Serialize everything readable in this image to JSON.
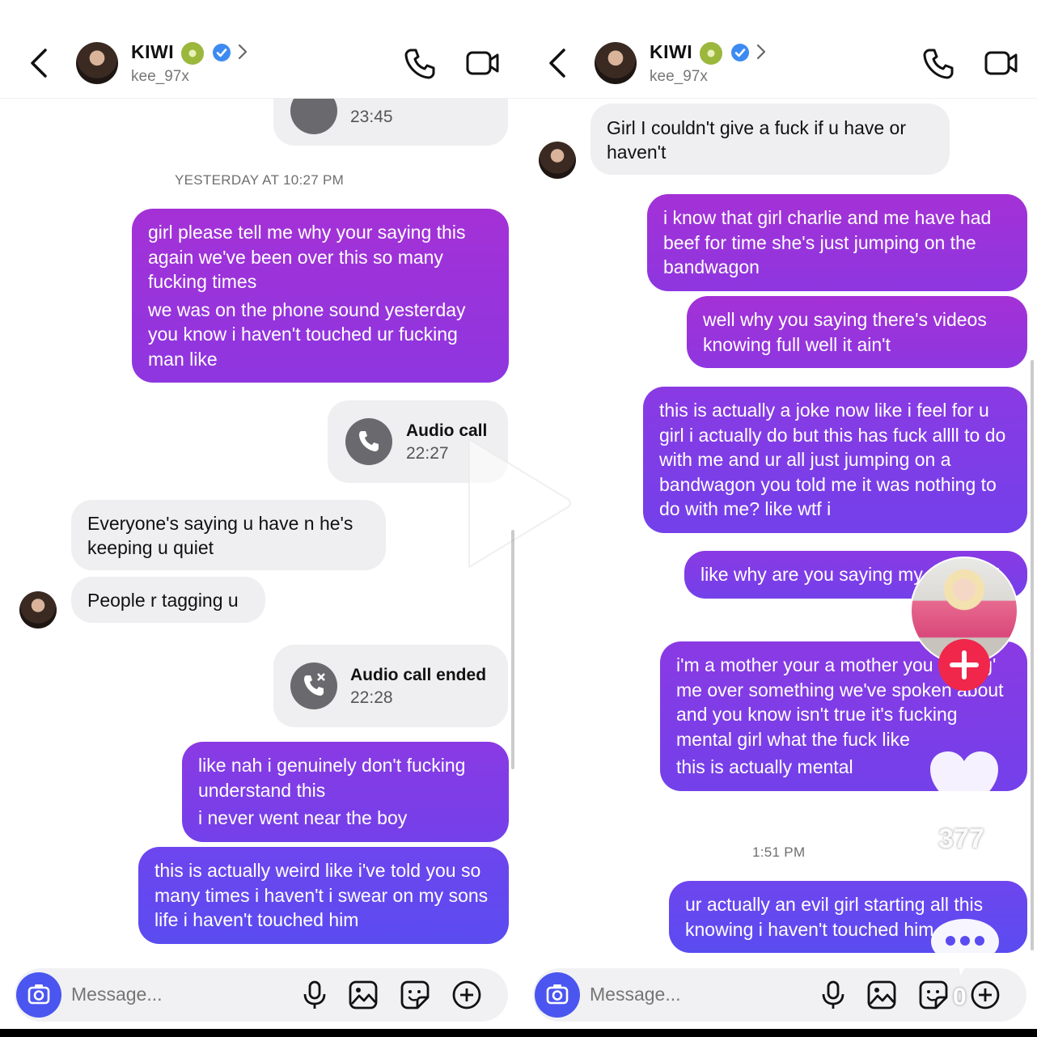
{
  "left": {
    "header": {
      "name": "KIWI",
      "handle": "kee_97x"
    },
    "top_call_time": "23:45",
    "timestamp": "YESTERDAY AT 10:27 PM",
    "msg1": [
      "girl please tell me why your saying this again we've been over this so many fucking times",
      "we was on the phone sound yesterday you know i haven't touched ur fucking man like"
    ],
    "call1": {
      "title": "Audio call",
      "time": "22:27"
    },
    "in1": "Everyone's saying u have n he's keeping u quiet",
    "in2": "People r tagging u",
    "call2": {
      "title": "Audio call ended",
      "time": "22:28"
    },
    "msg2": [
      "like nah i genuinely don't fucking understand this",
      "i never went near the boy"
    ],
    "msg3": "this is actually weird like i've told you so many times i haven't i swear on my sons life i haven't touched him",
    "composer": {
      "placeholder": "Message..."
    }
  },
  "right": {
    "header": {
      "name": "KIWI",
      "handle": "kee_97x"
    },
    "in1": "Girl I couldn't give a fuck if u have or haven't",
    "msg1": "i know that girl charlie and me have had beef for time she's just jumping on the bandwagon",
    "msg2": "well why you saying there's videos knowing full well it ain't",
    "msg3": "this is actually a joke now like i feel for u girl i actually do but this has fuck allll to do with me and ur all just jumping on a bandwagon you told me it was nothing to do with me? like wtf i",
    "msg4": "like why are you saying my name??!",
    "msg5": [
      "i'm a mother your a mother you 'outing' me over something we've spoken about and you know isn't true it's fucking mental girl what the fuck like",
      "this is actually mental"
    ],
    "timestamp": "1:51 PM",
    "msg6": "ur actually an evil girl starting all this knowing i haven't touched him",
    "composer": {
      "placeholder": "Message..."
    }
  },
  "overlay": {
    "likes": "377",
    "comments": "0"
  },
  "colors": {
    "accent": "#4b56f0",
    "verified": "#3d8bf2",
    "plus": "#f0264b"
  }
}
